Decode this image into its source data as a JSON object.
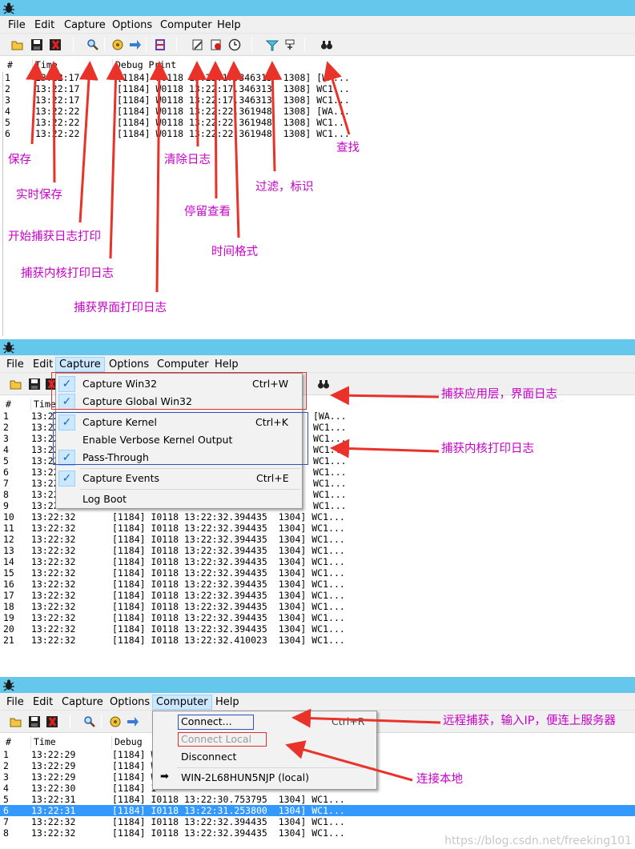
{
  "menus": [
    "File",
    "Edit",
    "Capture",
    "Options",
    "Computer",
    "Help"
  ],
  "columns": {
    "num": "#",
    "time": "Time",
    "debug": "Debug Print"
  },
  "panel1": {
    "rows": [
      {
        "n": "1",
        "t": "13:22:17",
        "d": "[1184] W0118 13:22:17.346313  1308] [WA..."
      },
      {
        "n": "2",
        "t": "13:22:17",
        "d": "[1184] W0118 13:22:17.346313  1308] WC1..."
      },
      {
        "n": "3",
        "t": "13:22:17",
        "d": "[1184] W0118 13:22:17.346313  1308] WC1..."
      },
      {
        "n": "4",
        "t": "13:22:22",
        "d": "[1184] W0118 13:22:22.361948  1308] [WA..."
      },
      {
        "n": "5",
        "t": "13:22:22",
        "d": "[1184] W0118 13:22:22.361948  1308] WC1..."
      },
      {
        "n": "6",
        "t": "13:22:22",
        "d": "[1184] W0118 13:22:22.361948  1308] WC1..."
      }
    ],
    "annotations": {
      "save": "保存",
      "realtime_save": "实时保存",
      "start_capture": "开始捕获日志打印",
      "capture_kernel": "捕获内核打印日志",
      "capture_ui": "捕获界面打印日志",
      "clear_log": "清除日志",
      "pause_view": "停留查看",
      "time_format": "时间格式",
      "filter_mark": "过滤，标识",
      "find": "查找"
    }
  },
  "panel2": {
    "rows": [
      {
        "n": "1",
        "t": "13:22",
        "d": "[WA..."
      },
      {
        "n": "2",
        "t": "13:22",
        "d": "WC1..."
      },
      {
        "n": "3",
        "t": "13:22",
        "d": "WC1..."
      },
      {
        "n": "4",
        "t": "13:22",
        "d": "WC1..."
      },
      {
        "n": "5",
        "t": "13:22",
        "d": "WC1..."
      },
      {
        "n": "6",
        "t": "13:22",
        "d": "WC1..."
      },
      {
        "n": "7",
        "t": "13:22",
        "d": "WC1..."
      },
      {
        "n": "8",
        "t": "13:22",
        "d": "WC1..."
      },
      {
        "n": "9",
        "t": "13:22",
        "d": "WC1..."
      },
      {
        "n": "10",
        "t": "13:22:32",
        "d": "[1184] I0118 13:22:32.394435  1304] WC1..."
      },
      {
        "n": "11",
        "t": "13:22:32",
        "d": "[1184] I0118 13:22:32.394435  1304] WC1..."
      },
      {
        "n": "12",
        "t": "13:22:32",
        "d": "[1184] I0118 13:22:32.394435  1304] WC1..."
      },
      {
        "n": "13",
        "t": "13:22:32",
        "d": "[1184] I0118 13:22:32.394435  1304] WC1..."
      },
      {
        "n": "14",
        "t": "13:22:32",
        "d": "[1184] I0118 13:22:32.394435  1304] WC1..."
      },
      {
        "n": "15",
        "t": "13:22:32",
        "d": "[1184] I0118 13:22:32.394435  1304] WC1..."
      },
      {
        "n": "16",
        "t": "13:22:32",
        "d": "[1184] I0118 13:22:32.394435  1304] WC1..."
      },
      {
        "n": "17",
        "t": "13:22:32",
        "d": "[1184] I0118 13:22:32.394435  1304] WC1..."
      },
      {
        "n": "18",
        "t": "13:22:32",
        "d": "[1184] I0118 13:22:32.394435  1304] WC1..."
      },
      {
        "n": "19",
        "t": "13:22:32",
        "d": "[1184] I0118 13:22:32.394435  1304] WC1..."
      },
      {
        "n": "20",
        "t": "13:22:32",
        "d": "[1184] I0118 13:22:32.394435  1304] WC1..."
      },
      {
        "n": "21",
        "t": "13:22:32",
        "d": "[1184] I0118 13:22:32.410023  1304] WC1..."
      }
    ],
    "capture_menu": [
      {
        "label": "Capture Win32",
        "shortcut": "Ctrl+W",
        "checked": true
      },
      {
        "label": "Capture Global Win32",
        "shortcut": "",
        "checked": true
      },
      {
        "label": "Capture Kernel",
        "shortcut": "Ctrl+K",
        "checked": true
      },
      {
        "label": "Enable Verbose Kernel Output",
        "shortcut": "",
        "checked": false
      },
      {
        "label": "Pass-Through",
        "shortcut": "",
        "checked": true
      },
      {
        "label": "Capture Events",
        "shortcut": "Ctrl+E",
        "checked": true
      },
      {
        "label": "Log Boot",
        "shortcut": "",
        "checked": false
      }
    ],
    "annotations": {
      "app_ui": "捕获应用层，界面日志",
      "kernel": "捕获内核打印日志"
    }
  },
  "panel3": {
    "rows": [
      {
        "n": "1",
        "t": "13:22:29",
        "d": "[1184] W",
        "sel": false
      },
      {
        "n": "2",
        "t": "13:22:29",
        "d": "[1184] W",
        "sel": false
      },
      {
        "n": "3",
        "t": "13:22:29",
        "d": "[1184] W",
        "sel": false
      },
      {
        "n": "4",
        "t": "13:22:30",
        "d": "[1184] I",
        "sel": false
      },
      {
        "n": "5",
        "t": "13:22:31",
        "d": "[1184] I0118 13:22:30.753795  1304] WC1...",
        "sel": false
      },
      {
        "n": "6",
        "t": "13:22:31",
        "d": "[1184] I0118 13:22:31.253800  1304] WC1...",
        "sel": true
      },
      {
        "n": "7",
        "t": "13:22:32",
        "d": "[1184] I0118 13:22:32.394435  1304] WC1...",
        "sel": false
      },
      {
        "n": "8",
        "t": "13:22:32",
        "d": "[1184] I0118 13:22:32.394435  1304] WC1...",
        "sel": false
      }
    ],
    "computer_menu": {
      "connect": "Connect...",
      "connect_shortcut": "Ctrl+R",
      "connect_local": "Connect Local",
      "disconnect": "Disconnect",
      "machine": "WIN-2L68HUN5NJP (local)"
    },
    "annotations": {
      "remote": "远程捕获，输入IP，便连上服务器",
      "local": "连接本地"
    },
    "watermark": "https://blog.csdn.net/freeking101"
  },
  "colors": {
    "titlebar": "#65c7ec",
    "annotation": "#c800c8",
    "arrow": "#e8322a",
    "selection": "#3399ff"
  }
}
